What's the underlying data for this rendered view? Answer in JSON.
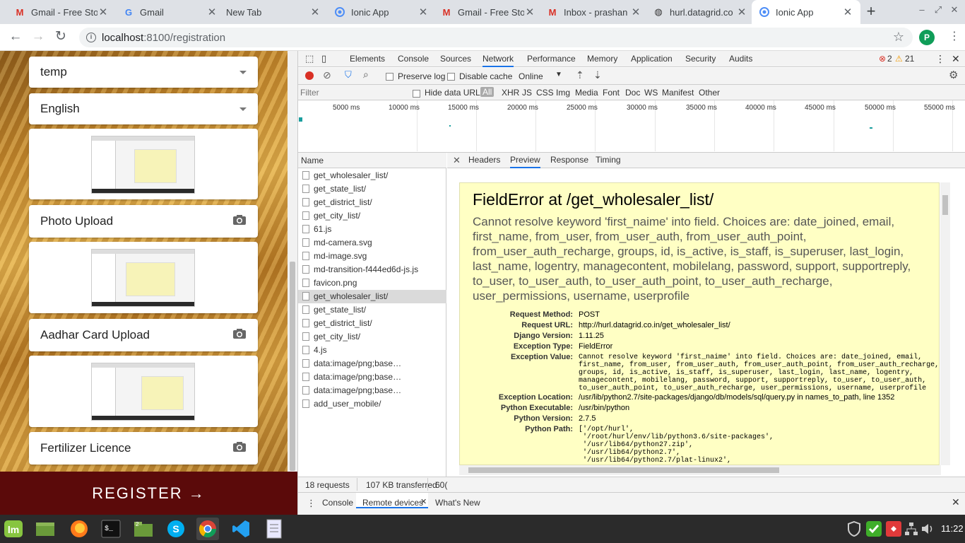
{
  "browser": {
    "tabs": [
      {
        "title": "Gmail - Free Sto",
        "icon": "gmail-icon"
      },
      {
        "title": "Gmail",
        "icon": "google-icon"
      },
      {
        "title": "New Tab",
        "icon": ""
      },
      {
        "title": "Ionic App",
        "icon": "ionic-icon"
      },
      {
        "title": "Gmail - Free Sto",
        "icon": "gmail-icon"
      },
      {
        "title": "Inbox - prashan",
        "icon": "gmail-icon"
      },
      {
        "title": "hurl.datagrid.co",
        "icon": "globe-icon"
      },
      {
        "title": "Ionic App",
        "icon": "ionic-icon",
        "active": true
      }
    ],
    "url_host": "localhost",
    "url_path": ":8100/registration",
    "avatar_letter": "P"
  },
  "app": {
    "select_1": "temp",
    "select_2": "English",
    "upload_1": "Photo Upload",
    "upload_2": "Aadhar Card Upload",
    "upload_3": "Fertilizer Licence",
    "register_label": "REGISTER →",
    "button_color": "#5b0a0a"
  },
  "devtools": {
    "tabs": [
      "Elements",
      "Console",
      "Sources",
      "Network",
      "Performance",
      "Memory",
      "Application",
      "Security",
      "Audits"
    ],
    "active_tab": "Network",
    "errors": "2",
    "warnings": "21",
    "toolbar": {
      "preserve_log": "Preserve log",
      "disable_cache": "Disable cache",
      "throttle": "Online"
    },
    "filter": {
      "placeholder": "Filter",
      "hide_data_urls": "Hide data URLs",
      "types": [
        "All",
        "XHR",
        "JS",
        "CSS",
        "Img",
        "Media",
        "Font",
        "Doc",
        "WS",
        "Manifest",
        "Other"
      ]
    },
    "timeline_labels": [
      "5000 ms",
      "10000 ms",
      "15000 ms",
      "20000 ms",
      "25000 ms",
      "30000 ms",
      "35000 ms",
      "40000 ms",
      "45000 ms",
      "50000 ms",
      "55000 ms"
    ],
    "names_header": "Name",
    "requests": [
      "get_wholesaler_list/",
      "get_state_list/",
      "get_district_list/",
      "get_city_list/",
      "61.js",
      "md-camera.svg",
      "md-image.svg",
      "md-transition-f444ed6d-js.js",
      "favicon.png",
      "get_wholesaler_list/",
      "get_state_list/",
      "get_district_list/",
      "get_city_list/",
      "4.js",
      "data:image/png;base…",
      "data:image/png;base…",
      "data:image/png;base…",
      "add_user_mobile/"
    ],
    "preview_tabs": [
      "Headers",
      "Preview",
      "Response",
      "Timing"
    ],
    "active_preview_tab": "Preview",
    "error": {
      "title": "FieldError at /get_wholesaler_list/",
      "description": "Cannot resolve keyword 'first_naime' into field. Choices are: date_joined, email, first_name, from_user, from_user_auth, from_user_auth_point, from_user_auth_recharge, groups, id, is_active, is_staff, is_superuser, last_login, last_name, logentry, managecontent, mobilelang, password, support, supportreply, to_user, to_user_auth, to_user_auth_point, to_user_auth_recharge, user_permissions, username, userprofile",
      "meta": {
        "request_method_label": "Request Method:",
        "request_method": "POST",
        "request_url_label": "Request URL:",
        "request_url": "http://hurl.datagrid.co.in/get_wholesaler_list/",
        "django_version_label": "Django Version:",
        "django_version": "1.11.25",
        "exception_type_label": "Exception Type:",
        "exception_type": "FieldError",
        "exception_value_label": "Exception Value:",
        "exception_value": "Cannot resolve keyword 'first_naime' into field. Choices are: date_joined, email,\nfirst_name, from_user, from_user_auth, from_user_auth_point, from_user_auth_recharge,\ngroups, id, is_active, is_staff, is_superuser, last_login, last_name, logentry,\nmanagecontent, mobilelang, password, support, supportreply, to_user, to_user_auth,\nto_user_auth_point, to_user_auth_recharge, user_permissions, username, userprofile",
        "exception_location_label": "Exception Location:",
        "exception_location": "/usr/lib/python2.7/site-packages/django/db/models/sql/query.py in names_to_path, line 1352",
        "python_executable_label": "Python Executable:",
        "python_executable": "/usr/bin/python",
        "python_version_label": "Python Version:",
        "python_version": "2.7.5",
        "python_path_label": "Python Path:",
        "python_path": "['/opt/hurl',\n '/root/hurl/env/lib/python3.6/site-packages',\n '/usr/lib64/python27.zip',\n '/usr/lib64/python2.7',\n '/usr/lib64/python2.7/plat-linux2',"
      }
    },
    "status": {
      "requests": "18 requests",
      "transferred": "107 KB transferred",
      "extra": "60("
    },
    "drawer": {
      "tabs": [
        "Console",
        "Remote devices",
        "What's New"
      ],
      "active": "Remote devices"
    }
  },
  "taskbar": {
    "time": "11:22"
  }
}
